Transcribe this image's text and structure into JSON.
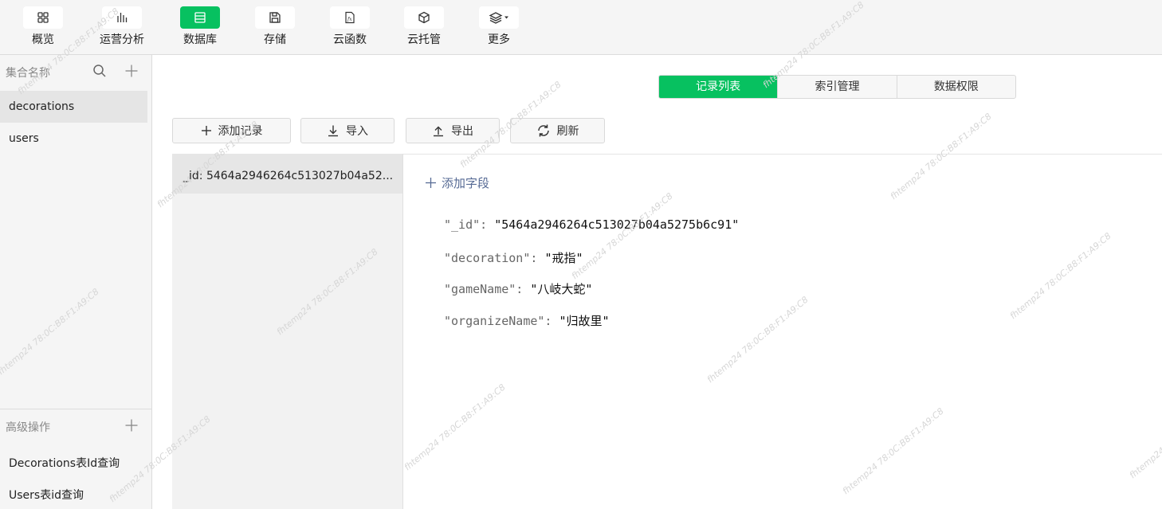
{
  "toolbar": {
    "items": [
      {
        "label": "概览",
        "icon": "grid-icon"
      },
      {
        "label": "运营分析",
        "icon": "bar-chart-icon"
      },
      {
        "label": "数据库",
        "icon": "database-icon"
      },
      {
        "label": "存储",
        "icon": "save-icon"
      },
      {
        "label": "云函数",
        "icon": "function-icon"
      },
      {
        "label": "云托管",
        "icon": "cube-icon"
      },
      {
        "label": "更多",
        "icon": "layers-icon"
      }
    ],
    "active": "数据库",
    "accent": "#07c160"
  },
  "sidebar": {
    "title": "集合名称",
    "collections": [
      "decorations",
      "users"
    ],
    "selected": "decorations",
    "advanced_title": "高级操作",
    "queries": [
      "Decorations表Id查询",
      "Users表id查询"
    ]
  },
  "tabs": {
    "items": [
      "记录列表",
      "索引管理",
      "数据权限"
    ],
    "active": "记录列表"
  },
  "actions": {
    "add_record": "添加记录",
    "import": "导入",
    "export": "导出",
    "refresh": "刷新"
  },
  "records": {
    "items": [
      "_id: 5464a2946264c513027b04a52..."
    ]
  },
  "detail": {
    "add_field": "添加字段",
    "fields": [
      {
        "key": "\"_id\": ",
        "value": "\"5464a2946264c513027b04a5275b6c91\""
      },
      {
        "key": "\"decoration\": ",
        "value": "\"戒指\""
      },
      {
        "key": "\"gameName\": ",
        "value": "\"八岐大蛇\""
      },
      {
        "key": "\"organizeName\": ",
        "value": "\"归故里\""
      }
    ]
  },
  "watermark": "fhtemp24 78:0C:B8:F1:A9:C8"
}
